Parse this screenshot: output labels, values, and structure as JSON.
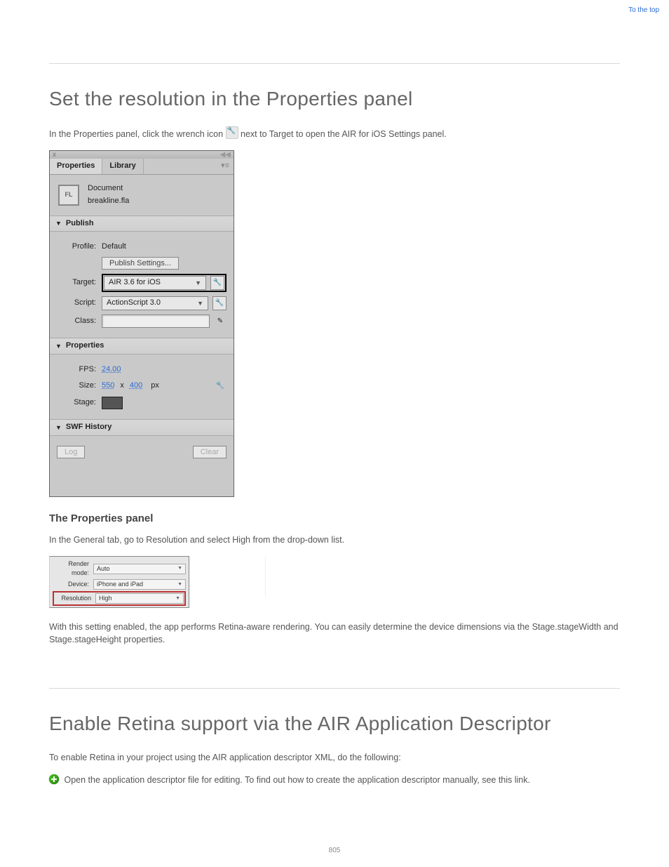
{
  "header": {
    "to_top": "To the top",
    "page_number": "805"
  },
  "s1": {
    "title": "Set the resolution in the Properties panel",
    "p1_a": "In the Properties panel, click the wrench icon ",
    "p1_b": " next to Target to open the AIR for iOS Settings panel."
  },
  "panel": {
    "tabs": {
      "properties": "Properties",
      "library": "Library"
    },
    "doc": {
      "type": "Document",
      "file": "breakline.fla",
      "thumb": "FL"
    },
    "publish": {
      "header": "Publish",
      "profile_label": "Profile:",
      "profile_value": "Default",
      "settings_btn": "Publish Settings...",
      "target_label": "Target:",
      "target_value": "AIR 3.6 for iOS",
      "script_label": "Script:",
      "script_value": "ActionScript 3.0",
      "class_label": "Class:"
    },
    "props": {
      "header": "Properties",
      "fps_label": "FPS:",
      "fps_value": "24.00",
      "size_label": "Size:",
      "size_w": "550",
      "size_x": "x",
      "size_h": "400",
      "size_unit": "px",
      "stage_label": "Stage:"
    },
    "swf": {
      "header": "SWF History",
      "log": "Log",
      "clear": "Clear"
    }
  },
  "mid": {
    "prop_title": "The Properties panel",
    "p2_a": "In the General tab, go to Resolution ",
    "p2_b": " and select High from the drop-down list."
  },
  "sp": {
    "render_label": "Render mode:",
    "render_value": "Auto",
    "device_label": "Device:",
    "device_value": "iPhone and iPad",
    "res_label": "Resolution",
    "res_value": "High"
  },
  "p3": "With this setting enabled, the app performs Retina-aware rendering. You can easily determine the device dimensions via the Stage.stageWidth and Stage.stageHeight properties.",
  "s2": {
    "title": "Enable Retina support via the AIR Application Descriptor",
    "intro": "To enable Retina in your project using the AIR application descriptor XML, do the following:",
    "step_a": "Open the application descriptor file for editing. ",
    "step_b": "To find out how to create the application descriptor manually, see this link."
  }
}
